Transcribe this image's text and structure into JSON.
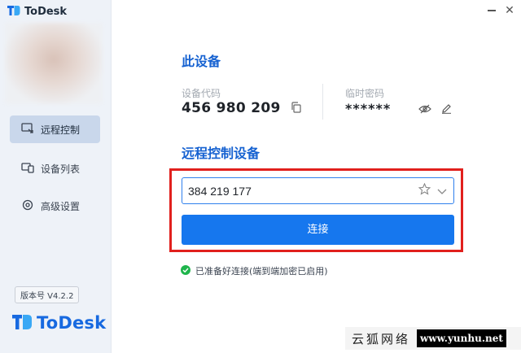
{
  "app": {
    "title": "ToDesk"
  },
  "sidebar": {
    "items": [
      {
        "label": "远程控制",
        "icon": "remote-control-icon",
        "active": true
      },
      {
        "label": "设备列表",
        "icon": "device-list-icon",
        "active": false
      },
      {
        "label": "高级设置",
        "icon": "settings-icon",
        "active": false
      }
    ],
    "version": "版本号 V4.2.2",
    "brand": "ToDesk"
  },
  "window_controls": {
    "minimize": "minimize-icon",
    "close": "✕"
  },
  "this_device": {
    "heading": "此设备",
    "code_label": "设备代码",
    "code_value": "456 980 209",
    "password_label": "临时密码",
    "password_value": "******"
  },
  "remote": {
    "heading": "远程控制设备",
    "device_id_value": "384 219 177",
    "connect_label": "连接"
  },
  "status": {
    "text": "已准备好连接(端到端加密已启用)"
  },
  "watermark": {
    "cn": "云狐网络",
    "url": "www.yunhu.net"
  },
  "colors": {
    "accent": "#1677ee",
    "heading": "#1662d1",
    "highlight": "#e1201d",
    "status_ok": "#1fb54c"
  }
}
